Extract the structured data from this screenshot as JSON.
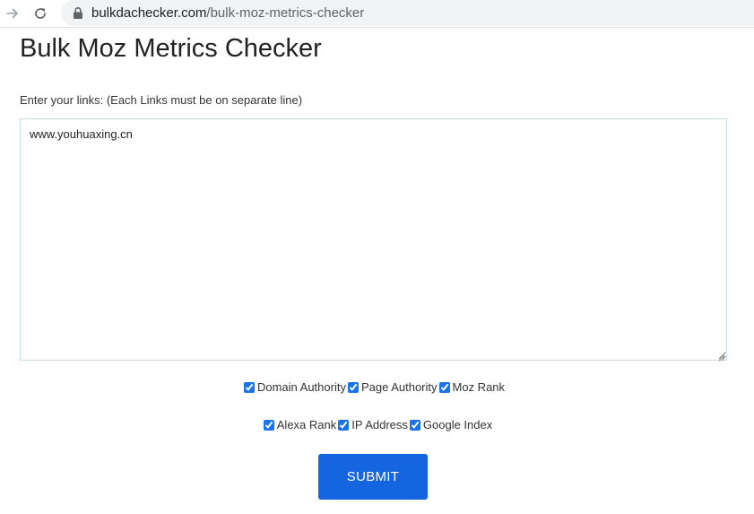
{
  "browser": {
    "url_domain": "bulkdachecker.com",
    "url_path": "/bulk-moz-metrics-checker"
  },
  "page": {
    "title": "Bulk Moz Metrics Checker",
    "links_label": "Enter your links: (Each Links must be on separate line)",
    "links_value": "www.youhuaxing.cn"
  },
  "options": [
    {
      "label": "Domain Authority",
      "checked": true
    },
    {
      "label": "Page Authority",
      "checked": true
    },
    {
      "label": "Moz Rank",
      "checked": true
    },
    {
      "label": "Alexa Rank",
      "checked": true
    },
    {
      "label": "IP Address",
      "checked": true
    },
    {
      "label": "Google Index",
      "checked": true
    }
  ],
  "submit_label": "SUBMIT",
  "colors": {
    "accent": "#1565e0",
    "textarea_border": "#c6dce4"
  },
  "icons": [
    "forward-arrow-icon",
    "reload-icon",
    "lock-icon"
  ]
}
